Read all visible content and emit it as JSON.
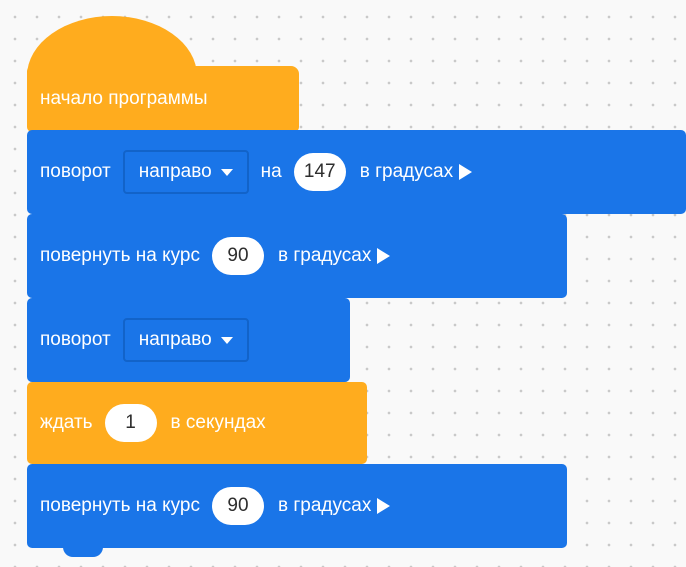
{
  "workspace": {
    "background": "#f9f9f9",
    "colors": {
      "motion_block": "#1a75e8",
      "control_block": "#ffac1e",
      "input_background": "#ffffff"
    }
  },
  "blocks": [
    {
      "type": "hat",
      "category": "control",
      "label": "начало программы"
    },
    {
      "type": "command",
      "category": "motion",
      "label": "поворот",
      "dropdown": "направо",
      "label2": "на",
      "value": "147",
      "suffix": "в градусах",
      "icon": "play-triangle-icon"
    },
    {
      "type": "command",
      "category": "motion",
      "label": "повернуть на курс",
      "value": "90",
      "suffix": "в градусах",
      "icon": "play-triangle-icon"
    },
    {
      "type": "command",
      "category": "motion",
      "label": "поворот",
      "dropdown": "направо"
    },
    {
      "type": "command",
      "category": "control",
      "label": "ждать",
      "value": "1",
      "suffix": "в секундах"
    },
    {
      "type": "command",
      "category": "motion",
      "label": "повернуть на курс",
      "value": "90",
      "suffix": "в градусах",
      "icon": "play-triangle-icon"
    }
  ]
}
